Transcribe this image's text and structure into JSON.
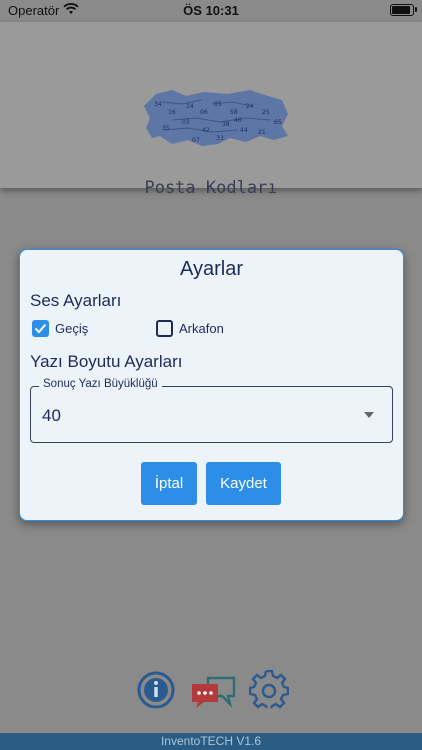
{
  "status_bar": {
    "carrier": "Operatör",
    "time": "ÖS 10:31"
  },
  "header": {
    "app_title": "Posta Kodları"
  },
  "dialog": {
    "title": "Ayarlar",
    "sound_section": "Ses Ayarları",
    "sound_options": [
      {
        "label": "Geçiş",
        "checked": true
      },
      {
        "label": "Arkafon",
        "checked": false
      }
    ],
    "font_section": "Yazı Boyutu Ayarları",
    "font_field": {
      "label": "Sonuç Yazı Büyüklüğü",
      "value": "40"
    },
    "cancel_label": "İptal",
    "save_label": "Kaydet"
  },
  "footer": {
    "version": "InventoTECH V1.6"
  },
  "colors": {
    "accent": "#2d8ee8",
    "text": "#1e2a5a",
    "footer": "#2b5d84"
  }
}
